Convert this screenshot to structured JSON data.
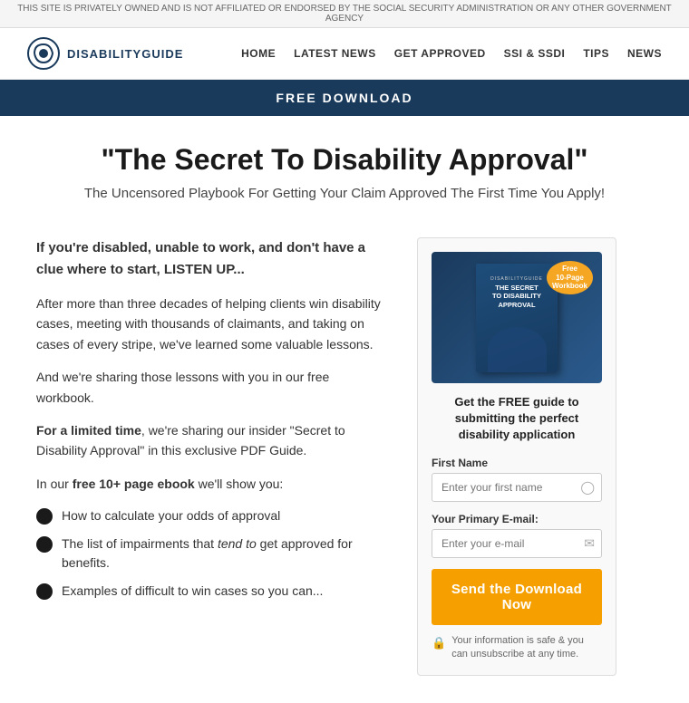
{
  "top_banner": {
    "text": "THIS SITE IS PRIVATELY OWNED AND IS NOT AFFILIATED OR ENDORSED BY THE SOCIAL SECURITY ADMINISTRATION OR ANY OTHER GOVERNMENT AGENCY"
  },
  "header": {
    "logo_text": "DisabilityGuide",
    "nav": [
      {
        "label": "HOME"
      },
      {
        "label": "LATEST NEWS"
      },
      {
        "label": "GET APPROVED"
      },
      {
        "label": "SSI & SSDI"
      },
      {
        "label": "TIPS"
      },
      {
        "label": "NEWS"
      }
    ]
  },
  "free_download_bar": {
    "label": "FREE DOWNLOAD"
  },
  "hero": {
    "title": "\"The Secret To Disability Approval\"",
    "subtitle": "The Uncensored Playbook For Getting Your Claim Approved The First Time You Apply!"
  },
  "main": {
    "intro_bold": "If you're disabled, unable to work, and don't have a clue where to start, LISTEN UP...",
    "para1": "After more than three decades of helping clients win disability cases, meeting with thousands of claimants, and taking on cases of every stripe, we've learned some valuable lessons.",
    "para2": "And we're sharing those lessons with you in our free workbook.",
    "para3_prefix": "For a limited time",
    "para3_suffix": ", we're sharing our insider \"Secret to Disability Approval\" in this exclusive PDF Guide.",
    "para4_prefix": "In our ",
    "para4_free": "free 10+ page ebook",
    "para4_suffix": " we'll show you:",
    "bullets": [
      {
        "text": "How to calculate your odds of approval"
      },
      {
        "text": "The list of impairments that tend to get approved for benefits."
      },
      {
        "text": "Examples of difficult to win cases so you can..."
      }
    ]
  },
  "form_card": {
    "book_badge": "Free\n10-Page\nWorkbook",
    "book_title": "THE SECRET\nTO DISABILITY\nAPPROVAL",
    "tagline": "Get the FREE guide to submitting the perfect disability application",
    "first_name_label": "First Name",
    "first_name_placeholder": "Enter your first name",
    "email_label": "Your Primary E-mail:",
    "email_placeholder": "Enter your e-mail",
    "submit_label": "Send the Download Now",
    "safe_text": "Your information is safe & you can unsubscribe at any time."
  }
}
